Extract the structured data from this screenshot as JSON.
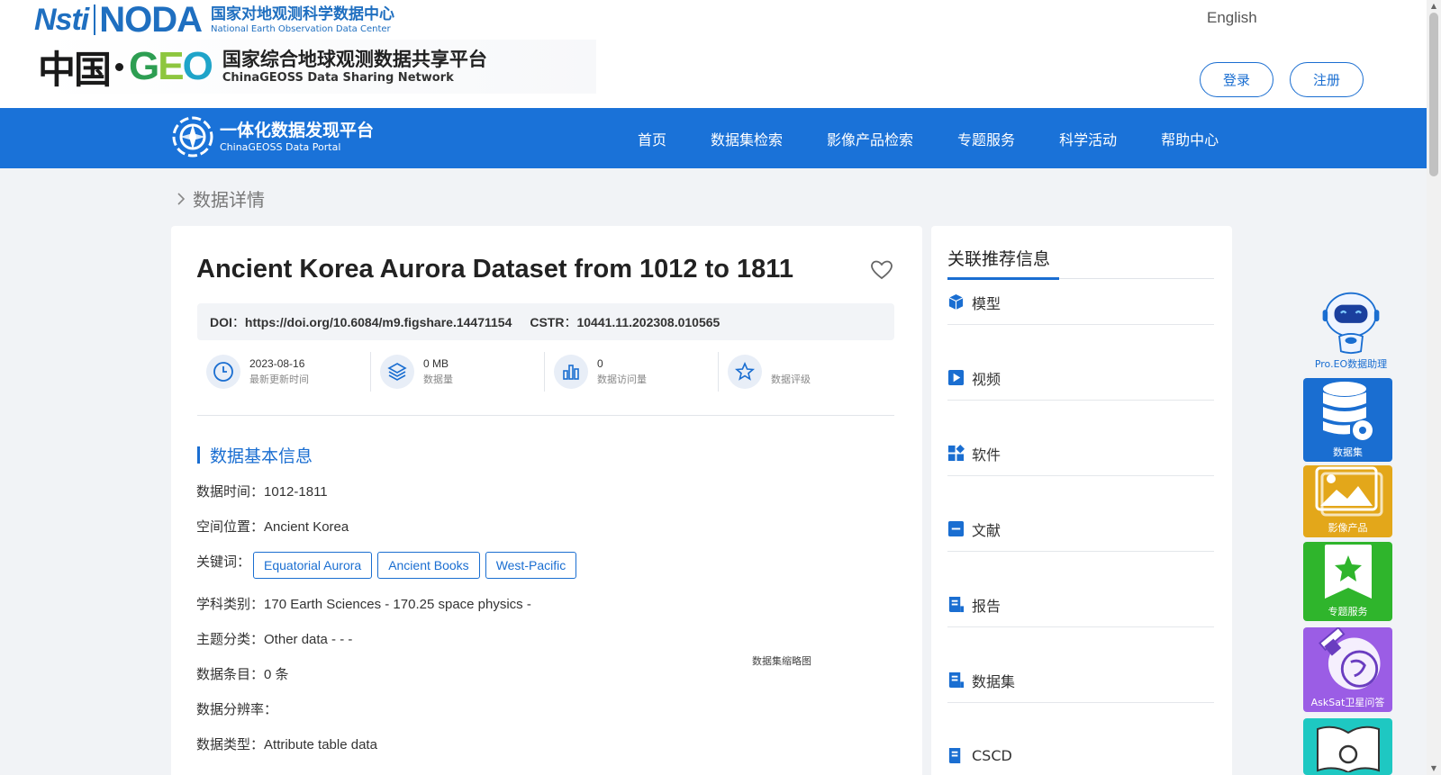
{
  "header": {
    "org_logo_text": "Nsti",
    "noda_logo_text": "NODA",
    "noda_name_cn": "国家对地观测科学数据中心",
    "noda_name_en": "National Earth Observation Data Center",
    "china_char": "中国",
    "geo_logo_text": "GEO",
    "platform_name_cn": "国家综合地球观测数据共享平台",
    "platform_name_en": "ChinaGEOSS Data Sharing Network",
    "language_link": "English",
    "login_label": "登录",
    "register_label": "注册"
  },
  "navbar": {
    "portal_name_cn": "一体化数据发现平台",
    "portal_name_en": "ChinaGEOSS Data Portal",
    "items": [
      "首页",
      "数据集检索",
      "影像产品检索",
      "专题服务",
      "科学活动",
      "帮助中心"
    ]
  },
  "breadcrumb": {
    "current": "数据详情"
  },
  "dataset": {
    "title": "Ancient Korea Aurora Dataset from 1012 to 1811",
    "doi_label": "DOI",
    "doi_value": "https://doi.org/10.6084/m9.figshare.14471154",
    "cstr_label": "CSTR",
    "cstr_value": "10441.11.202308.010565",
    "stats": [
      {
        "icon": "clock-icon",
        "value": "2023-08-16",
        "label": "最新更新时间"
      },
      {
        "icon": "layers-icon",
        "value": "0 MB",
        "label": "数据量"
      },
      {
        "icon": "bar-chart-icon",
        "value": "0",
        "label": "数据访问量"
      },
      {
        "icon": "star-icon",
        "value": "",
        "label": "数据评级"
      }
    ],
    "section_title": "数据基本信息",
    "time_key": "数据时间：",
    "time_val": "1012-1811",
    "location_key": "空间位置：",
    "location_val": "Ancient Korea",
    "keywords_key": "关键词：",
    "keywords": [
      "Equatorial Aurora",
      "Ancient Books",
      "West-Pacific"
    ],
    "discipline_key": "学科类别：",
    "discipline_val": "170 Earth Sciences - 170.25 space physics -",
    "topic_key": "主题分类：",
    "topic_val": "Other data - - -",
    "entries_key": "数据条目：",
    "entries_val": "0 条",
    "resolution_key": "数据分辨率：",
    "resolution_val": "",
    "type_key": "数据类型：",
    "type_val": "Attribute table data",
    "thumbnail_label": "数据集缩略图"
  },
  "recommend": {
    "title": "关联推荐信息",
    "items": [
      {
        "icon": "cube-icon",
        "label": "模型"
      },
      {
        "icon": "video-icon",
        "label": "视频"
      },
      {
        "icon": "software-icon",
        "label": "软件"
      },
      {
        "icon": "document-icon",
        "label": "文献"
      },
      {
        "icon": "report-icon",
        "label": "报告"
      },
      {
        "icon": "dataset-icon",
        "label": "数据集"
      },
      {
        "icon": "dataset-icon",
        "label": "CSCD"
      }
    ]
  },
  "float_tools": {
    "assistant_label": "Pro.EO数据助理",
    "dataset_label": "数据集",
    "image_label": "影像产品",
    "topic_label": "专题服务",
    "asksat_label": "AskSat卫星问答"
  },
  "colors": {
    "primary": "#1a72d8",
    "tile_dataset": "#1a6ed1",
    "tile_image": "#e3a71a",
    "tile_topic": "#2fb52c",
    "tile_asksat": "#9b5de5",
    "tile_next": "#1ec8c2"
  }
}
